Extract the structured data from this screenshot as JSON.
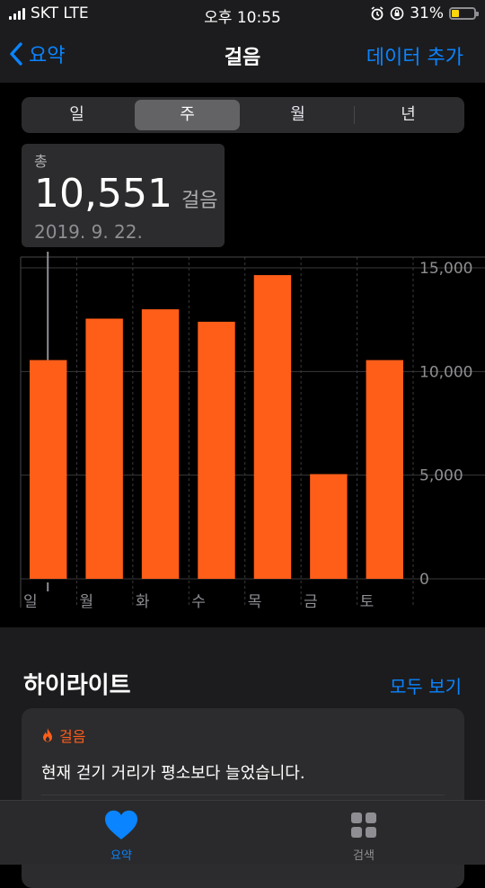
{
  "status": {
    "carrier": "SKT LTE",
    "time": "오후 10:55",
    "battery": "31%",
    "battery_level": 0.31
  },
  "nav": {
    "back_label": "요약",
    "title": "걸음",
    "action_label": "데이터 추가"
  },
  "segments": [
    "일",
    "주",
    "월",
    "년"
  ],
  "selected_segment": "주",
  "tooltip": {
    "label": "총",
    "value": "10,551",
    "unit": "걸음",
    "date": "2019. 9. 22."
  },
  "chart_data": {
    "type": "bar",
    "categories": [
      "일",
      "월",
      "화",
      "수",
      "목",
      "금",
      "토"
    ],
    "values": [
      10551,
      12550,
      13000,
      12400,
      14650,
      5050,
      10550
    ],
    "ylim": [
      0,
      15000
    ],
    "yticks": [
      "15,000",
      "10,000",
      "5,000",
      "0"
    ],
    "ytick_values": [
      15000,
      10000,
      5000,
      0
    ],
    "selected_index": 0,
    "bar_color": "#ff5e19"
  },
  "highlights": {
    "title": "하이라이트",
    "see_all": "모두 보기",
    "card_category": "걸음",
    "card_text": "현재 걷기 거리가 평소보다 늘었습니다."
  },
  "tabs": [
    {
      "label": "요약",
      "icon": "heart-icon",
      "active": true
    },
    {
      "label": "검색",
      "icon": "grid-icon",
      "active": false
    }
  ],
  "colors": {
    "accent": "#0a84ff",
    "bar": "#ff5e19",
    "battery": "#ffd60a"
  }
}
